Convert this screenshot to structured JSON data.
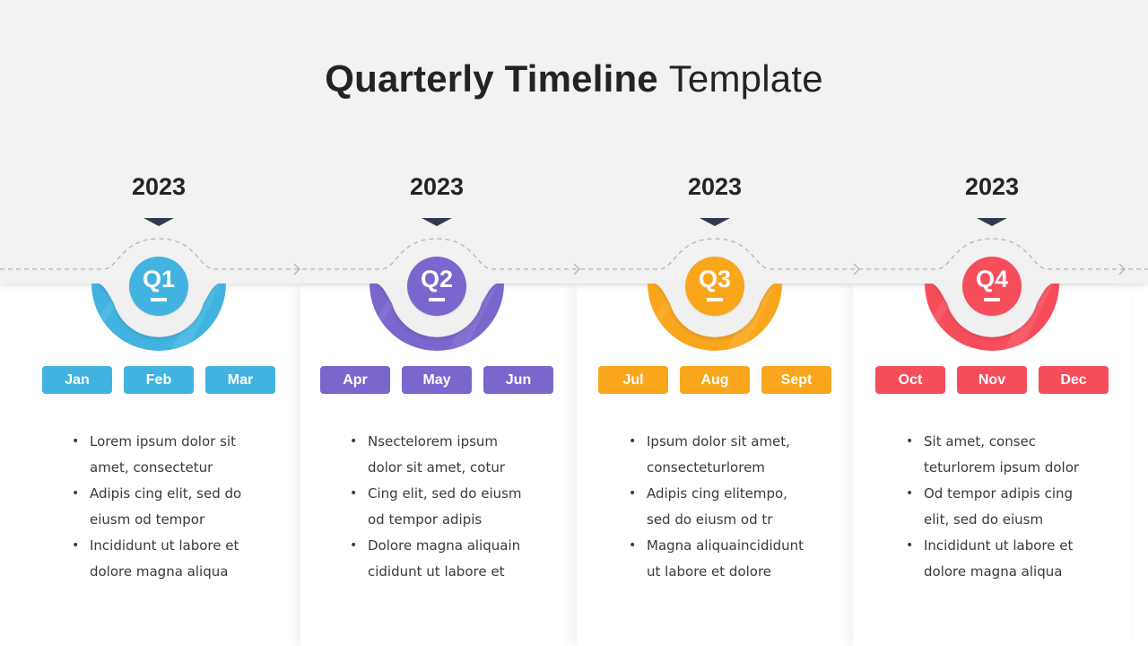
{
  "title": {
    "bold": "Quarterly Timeline",
    "light": "Template"
  },
  "colors": {
    "band": "#f2f2f2",
    "dash": "#9aa7ad",
    "pointer": "#2e3a4e",
    "q1": "#42b3e0",
    "q2": "#7a66cd",
    "q3": "#f9a61c",
    "q4": "#f64d5b"
  },
  "quarters": [
    {
      "year": "2023",
      "label": "Q1",
      "color": "#42b3e0",
      "light": "#5cc3ea",
      "months": [
        "Jan",
        "Feb",
        "Mar"
      ],
      "bullets": [
        "Lorem ipsum dolor sit amet, consectetur",
        "Adipis cing elit, sed do eiusm od tempor",
        "Incididunt ut labore et dolore magna aliqua"
      ]
    },
    {
      "year": "2023",
      "label": "Q2",
      "color": "#7a66cd",
      "light": "#8d7ad8",
      "months": [
        "Apr",
        "May",
        "Jun"
      ],
      "bullets": [
        "Nsectelorem ipsum dolor sit amet, cotur",
        "Cing elit, sed do eiusm od tempor adipis",
        "Dolore magna aliquain cididunt ut labore et"
      ]
    },
    {
      "year": "2023",
      "label": "Q3",
      "color": "#f9a61c",
      "light": "#fbb43c",
      "months": [
        "Jul",
        "Aug",
        "Sept"
      ],
      "bullets": [
        "Ipsum dolor sit amet, consecteturlorem",
        "Adipis cing elitempo, sed do eiusm od tr",
        "Magna aliquaincididunt ut labore et dolore"
      ]
    },
    {
      "year": "2023",
      "label": "Q4",
      "color": "#f64d5b",
      "light": "#fa6b77",
      "months": [
        "Oct",
        "Nov",
        "Dec"
      ],
      "bullets": [
        "Sit amet, consec teturlorem ipsum dolor",
        "Od tempor adipis cing elit, sed do eiusm",
        "Incididunt ut labore et dolore magna aliqua"
      ]
    }
  ]
}
